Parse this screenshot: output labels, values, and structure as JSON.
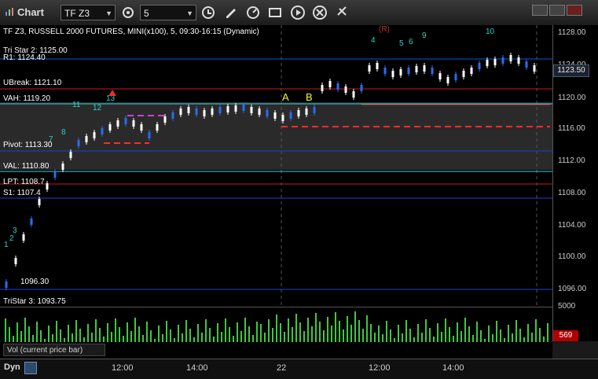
{
  "window": {
    "title": "Chart",
    "symbol": "TF Z3",
    "interval": "5"
  },
  "toolbar": {
    "icons": [
      "settings-icon",
      "history-icon",
      "pencil-icon",
      "refresh-icon",
      "snapshot-icon",
      "play-icon",
      "close-icon",
      "link-icon"
    ]
  },
  "chart_data": {
    "type": "candlestick",
    "title": "TF Z3, RUSSELL 2000 FUTURES, MINI(x100), 5, 09:30-16:15 (Dynamic)",
    "current_price": "1123.50",
    "levels": [
      {
        "label": "Tri Star 2: 1125.00",
        "color": "#ffffff"
      },
      {
        "label": "R1: 1124.40",
        "color": "#ffffff"
      },
      {
        "label": "UBreak: 1121.10",
        "color": "#ffffff"
      },
      {
        "label": "VAH: 1119.20",
        "color": "#ffffff"
      },
      {
        "label": "Pivot: 1113.30",
        "color": "#ffffff"
      },
      {
        "label": "VAL: 1110.80",
        "color": "#ffffff"
      },
      {
        "label": "LPT: 1108.7",
        "color": "#ffffff"
      },
      {
        "label": "S1: 1107.4",
        "color": "#ffffff"
      },
      {
        "label": "1096.30",
        "color": "#ffffff"
      },
      {
        "label": "TriStar 3: 1093.75",
        "color": "#ffffff"
      }
    ],
    "price_axis": [
      "1128.00",
      "1124.00",
      "1120.00",
      "1116.00",
      "1112.00",
      "1108.00",
      "1104.00",
      "1100.00",
      "1096.00"
    ],
    "time_axis": [
      "12:00",
      "14:00",
      "22",
      "12:00",
      "14:00"
    ],
    "markers": [
      "A",
      "B",
      "(R)",
      "4",
      "5",
      "6",
      "9",
      "10",
      "11",
      "12",
      "13",
      "8",
      "7",
      "3",
      "2",
      "1"
    ],
    "volume": {
      "label": "Vol (current price bar)",
      "current": "569",
      "axis_top": "5000"
    }
  },
  "status": {
    "mode": "Dyn"
  }
}
